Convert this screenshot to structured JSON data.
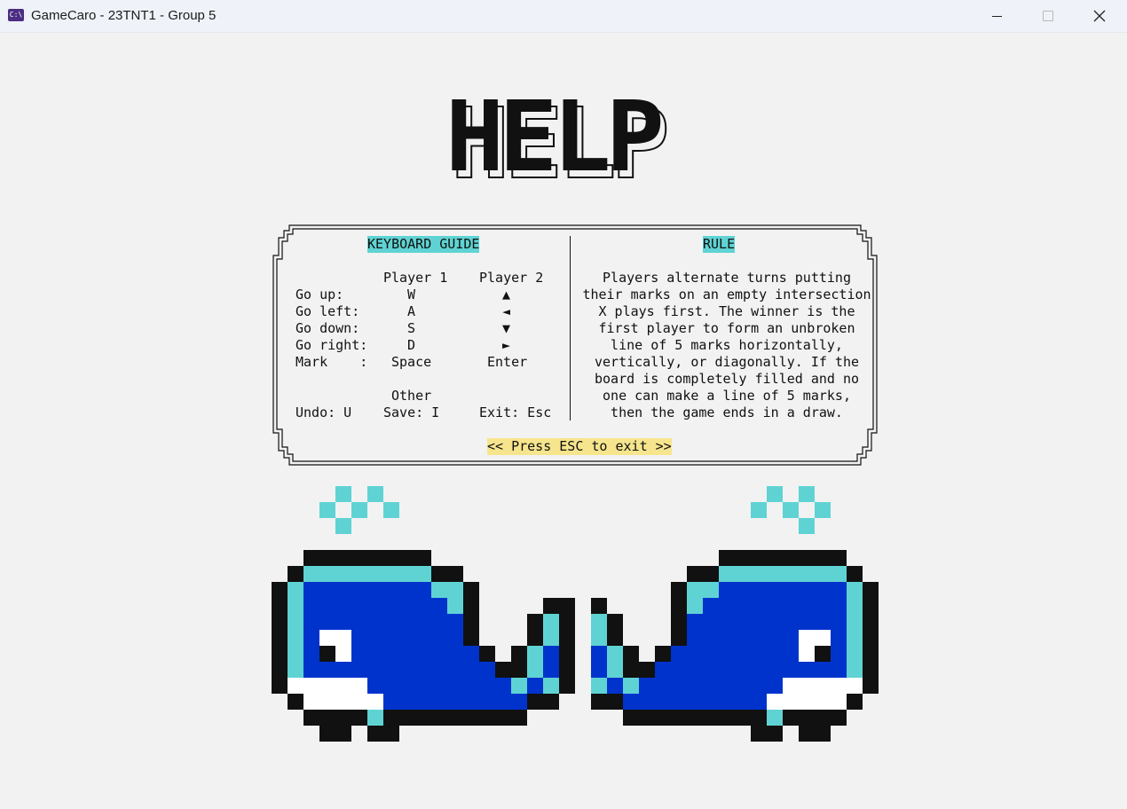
{
  "window": {
    "title": "GameCaro - 23TNT1 - Group 5",
    "icon": "console-app-icon",
    "icon_text": "C:\\"
  },
  "logo": {
    "text": "HELP"
  },
  "keyboard_guide": {
    "heading": "KEYBOARD GUIDE",
    "col_player1": "Player 1",
    "col_player2": "Player 2",
    "rows": [
      {
        "action": "Go up:",
        "p1": "W",
        "p2": "▲"
      },
      {
        "action": "Go left:",
        "p1": "A",
        "p2": "◄"
      },
      {
        "action": "Go down:",
        "p1": "S",
        "p2": "▼"
      },
      {
        "action": "Go right:",
        "p1": "D",
        "p2": "►"
      },
      {
        "action": "Mark    :",
        "p1": "Space",
        "p2": "Enter"
      }
    ],
    "other_heading": "Other",
    "undo": "Undo: U",
    "save": "Save: I",
    "exit": "Exit: Esc"
  },
  "rule": {
    "heading": "RULE",
    "lines": [
      "Players alternate turns putting",
      "their marks on an empty intersection",
      "X plays first. The winner is the",
      "first player to form an unbroken",
      "line of 5 marks horizontally,",
      "vertically, or diagonally. If the",
      "board is completely filled and no",
      "one can make a line of 5 marks,",
      "then the game ends in a draw."
    ]
  },
  "footer": {
    "exit_hint": "<< Press ESC to exit >>"
  },
  "colors": {
    "background": "#f2f2f2",
    "cyan": "#5fd3d3",
    "blue": "#0033cc",
    "yellow_highlight": "#f6e58d",
    "black": "#111111"
  }
}
